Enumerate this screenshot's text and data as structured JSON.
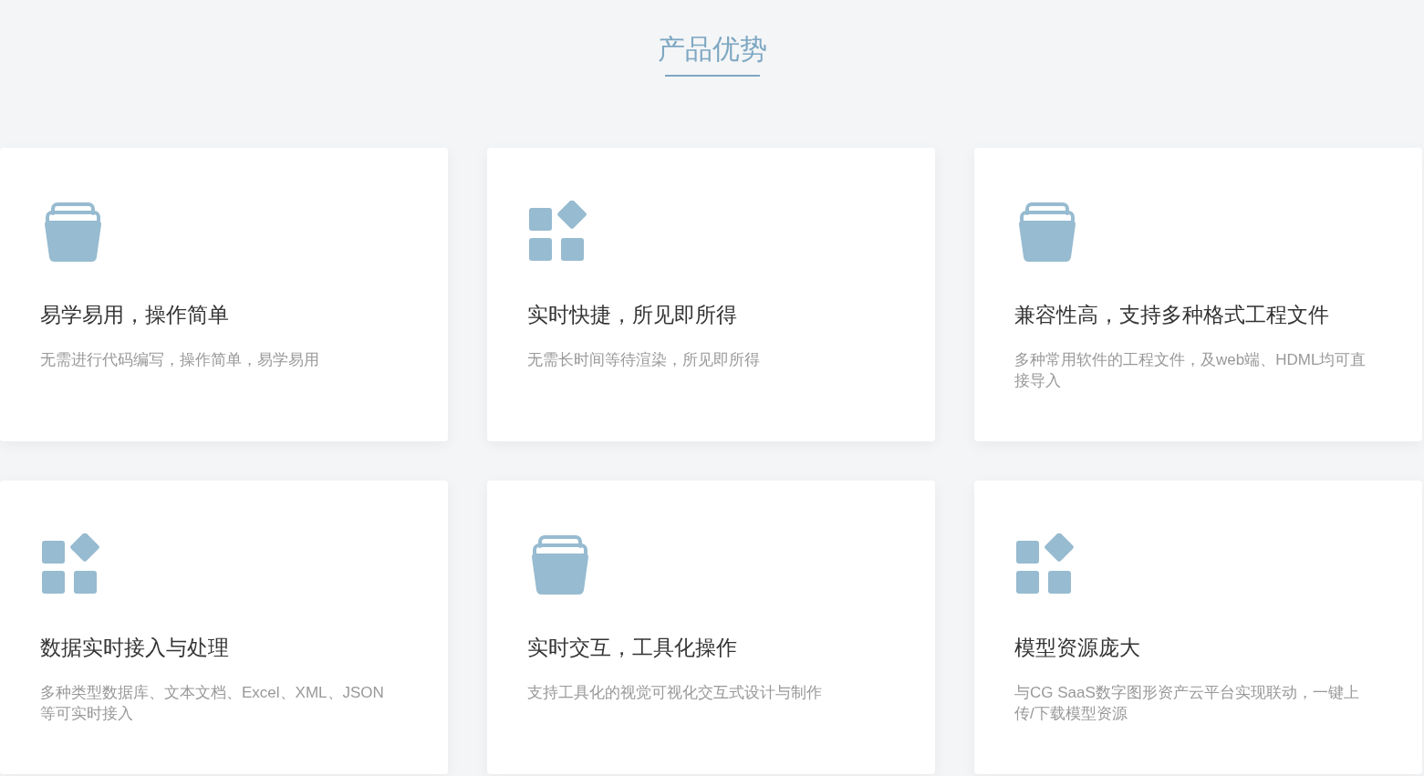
{
  "section_title": "产品优势",
  "cards": [
    {
      "kind": "tray",
      "title": "易学易用，操作简单",
      "description": "无需进行代码编写，操作简单，易学易用"
    },
    {
      "kind": "grid",
      "title": "实时快捷，所见即所得",
      "description": "无需长时间等待渲染，所见即所得"
    },
    {
      "kind": "tray",
      "title": "兼容性高，支持多种格式工程文件",
      "description": "多种常用软件的工程文件，及web端、HDML均可直接导入"
    },
    {
      "kind": "grid",
      "title": "数据实时接入与处理",
      "description": "多种类型数据库、文本文档、Excel、XML、JSON等可实时接入"
    },
    {
      "kind": "tray",
      "title": "实时交互，工具化操作",
      "description": "支持工具化的视觉可视化交互式设计与制作"
    },
    {
      "kind": "grid",
      "title": "模型资源庞大",
      "description": "与CG SaaS数字图形资产云平台实现联动，一键上传/下载模型资源"
    }
  ]
}
